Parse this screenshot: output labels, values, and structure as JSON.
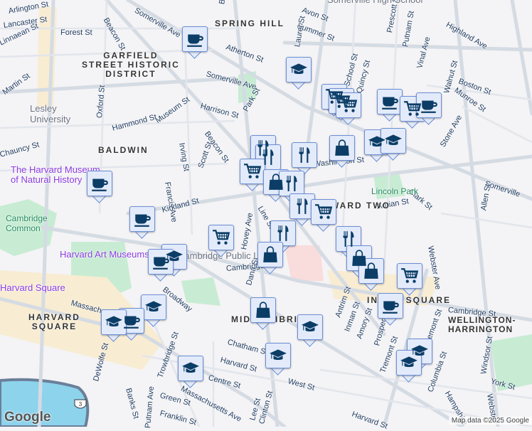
{
  "labels": {
    "streets": [
      "Arlington St",
      "Lancaster St",
      "Forest St",
      "Linnaean St",
      "Martin St",
      "Beacon St",
      "Somerville Ave",
      "Belmont",
      "Atherton St",
      "Somerville Ave",
      "Harrison St",
      "Park St",
      "Beacon St",
      "Museum St",
      "Hammond St",
      "Oxford St",
      "Chauncy St",
      "Irving St",
      "Francis Ave",
      "Scott St",
      "Kirkland St",
      "Line St",
      "Avon St",
      "Summer St",
      "Laurel St",
      "Prescott St",
      "Putnam St",
      "Highland Ave",
      "Vinal Ave",
      "Walnut St",
      "Boston St",
      "Munroe St",
      "School St",
      "Quincy St",
      "Stone Ave",
      "Washington St",
      "Clark St",
      "Adrian St",
      "Somerville",
      "Allen St",
      "Webster Ave",
      "Hovey Ave",
      "Cambridge St",
      "Dana St",
      "Broadway",
      "Trowbridge St",
      "Chatham St",
      "Harvard St",
      "Centre St",
      "Massachusetts Ave",
      "Massachusetts Ave",
      "DeWolfe St",
      "Banks St",
      "Putnam Ave",
      "Green St",
      "Franklin St",
      "Lee St",
      "Clinton St",
      "West St",
      "Antrim St",
      "Inman St",
      "Amory St",
      "Prospect",
      "Tremont St",
      "Cambridge St",
      "Columbia St",
      "Hampshire",
      "Windsor St",
      "York St",
      "Webster",
      "Tremont St",
      "Harvard St"
    ],
    "areas": [
      "SPRING HILL",
      "GARFIELD\nSTREET HISTORIC\nDISTRICT",
      "BALDWIN",
      "HARVARD\nSQUARE",
      "WARD TWO",
      "MID-CAMBRIDGE",
      "INMAN SQUARE",
      "WELLINGTON-HARRINGTON"
    ],
    "parks": [
      "Cambridge\nCommon",
      "Lincoln Park"
    ],
    "pois": [
      "The Harvard Museum\nof Natural History",
      "Harvard Art Museums",
      "Harvard Square",
      "Cambridge Public Library"
    ],
    "university": "Lesley\nUniversity",
    "high_school": "Somerville High School",
    "route_shield": "3"
  },
  "markers": [
    "cafe",
    "school",
    "shopping-cart",
    "shopping-cart",
    "shopping-cart",
    "cafe",
    "shopping-cart",
    "cafe",
    "restaurant",
    "restaurant",
    "shopping-cart",
    "restaurant",
    "shopping-bag",
    "school",
    "school",
    "shopping-bag",
    "restaurant",
    "restaurant",
    "shopping-cart",
    "cafe",
    "cafe",
    "shopping-cart",
    "restaurant",
    "shopping-bag",
    "school",
    "cafe",
    "restaurant",
    "shopping-bag",
    "shopping-bag",
    "shopping-cart",
    "cafe",
    "school",
    "cafe",
    "school",
    "shopping-bag",
    "school",
    "school",
    "school",
    "school",
    "school"
  ],
  "colors": {
    "marker_fill": "#e3ebfb",
    "marker_border": "#6b8fd6",
    "icon": "#0b3d66",
    "road": "#d5dbe3",
    "park": "#b6e3c7",
    "water": "#8dd3ec"
  },
  "attribution": {
    "logo": "Google",
    "text": "Map data ©2025 Google"
  }
}
